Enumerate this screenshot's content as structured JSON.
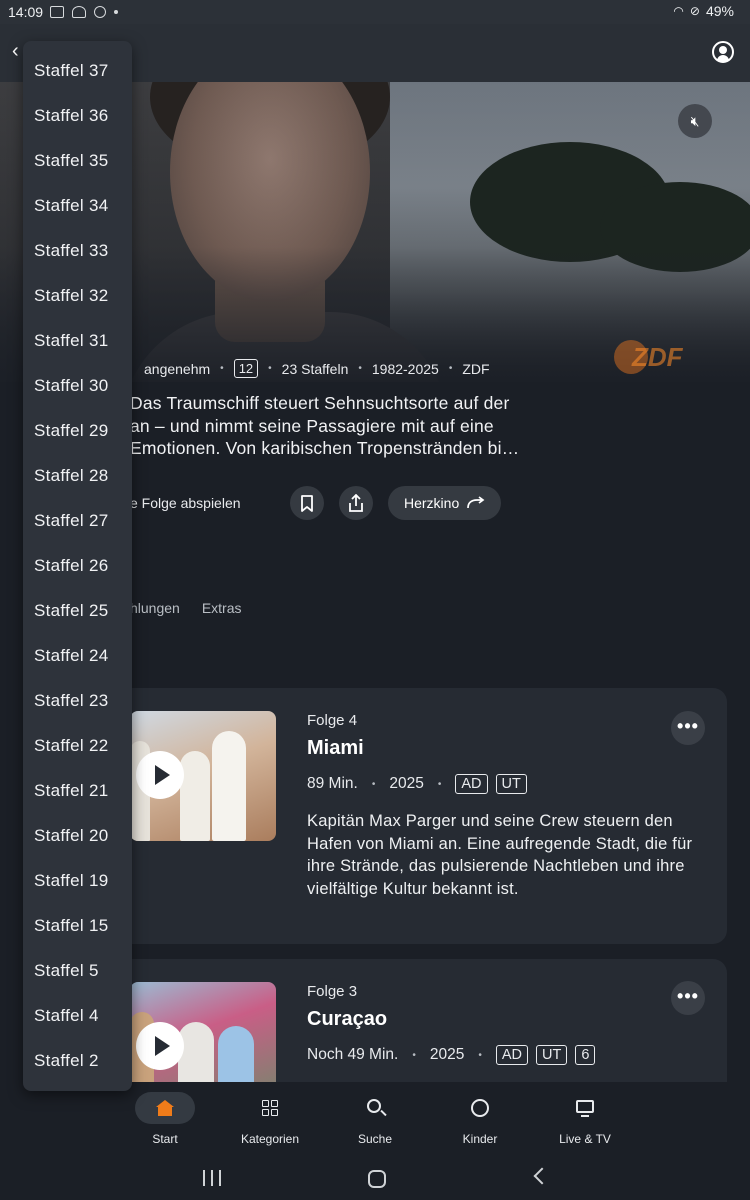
{
  "status_bar": {
    "time": "14:09",
    "battery": "49%"
  },
  "hero": {
    "meta": [
      "angenehm",
      "12",
      "23 Staffeln",
      "1982-2025",
      "ZDF"
    ],
    "description": "Das Traumschiff steuert Sehnsuchtsorte auf der\nan – und nimmt seine Passagiere mit auf eine\nEmotionen. Von karibischen Tropenstränden bi…",
    "play_label": "e Folge abspielen",
    "genre_button": "Herzkino",
    "logo_text": "ZDF"
  },
  "tabs": [
    "hlungen",
    "Extras"
  ],
  "episodes": [
    {
      "label": "Folge 4",
      "title": "Miami",
      "duration": "89 Min.",
      "year": "2025",
      "badges": [
        "AD",
        "UT"
      ],
      "description": "Kapitän Max Parger und seine Crew steuern den Hafen von Miami an. Eine aufregende Stadt, die für ihre Strände, das pulsierende Nachtleben und ihre vielfältige Kultur bekannt ist."
    },
    {
      "label": "Folge 3",
      "title": "Curaçao",
      "duration": "Noch 49 Min.",
      "year": "2025",
      "badges": [
        "AD",
        "UT",
        "6"
      ]
    }
  ],
  "season_dropdown": {
    "options": [
      "Staffel 37",
      "Staffel 36",
      "Staffel 35",
      "Staffel 34",
      "Staffel 33",
      "Staffel 32",
      "Staffel 31",
      "Staffel 30",
      "Staffel 29",
      "Staffel 28",
      "Staffel 27",
      "Staffel 26",
      "Staffel 25",
      "Staffel 24",
      "Staffel 23",
      "Staffel 22",
      "Staffel 21",
      "Staffel 20",
      "Staffel 19",
      "Staffel 15",
      "Staffel 5",
      "Staffel 4",
      "Staffel 2"
    ]
  },
  "bottom_nav": [
    {
      "label": "Start",
      "icon": "home-icon",
      "active": true
    },
    {
      "label": "Kategorien",
      "icon": "grid-icon"
    },
    {
      "label": "Suche",
      "icon": "search-icon"
    },
    {
      "label": "Kinder",
      "icon": "kids-icon"
    },
    {
      "label": "Live & TV",
      "icon": "tv-icon"
    }
  ],
  "colors": {
    "accent": "#f07c1a",
    "background": "#1b1f26",
    "card": "#262b33"
  }
}
